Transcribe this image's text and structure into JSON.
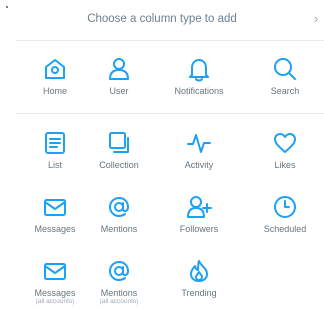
{
  "header": {
    "title": "Choose a column type to add",
    "close_glyph": "›"
  },
  "accent_color": "#1da1f2",
  "rows": [
    [
      {
        "name": "home",
        "label": "Home",
        "icon": "home-icon"
      },
      {
        "name": "user",
        "label": "User",
        "icon": "user-icon"
      },
      {
        "name": "notifications",
        "label": "Notifications",
        "icon": "bell-icon"
      },
      {
        "name": "search",
        "label": "Search",
        "icon": "search-icon"
      }
    ],
    [
      {
        "name": "list",
        "label": "List",
        "icon": "list-icon"
      },
      {
        "name": "collection",
        "label": "Collection",
        "icon": "collection-icon"
      },
      {
        "name": "activity",
        "label": "Activity",
        "icon": "activity-icon"
      },
      {
        "name": "likes",
        "label": "Likes",
        "icon": "heart-icon"
      }
    ],
    [
      {
        "name": "messages",
        "label": "Messages",
        "icon": "envelope-icon"
      },
      {
        "name": "mentions",
        "label": "Mentions",
        "icon": "at-icon"
      },
      {
        "name": "followers",
        "label": "Followers",
        "icon": "add-user-icon"
      },
      {
        "name": "scheduled",
        "label": "Scheduled",
        "icon": "clock-icon"
      }
    ],
    [
      {
        "name": "messages-all",
        "label": "Messages",
        "sub": "(all accounts)",
        "icon": "envelope-icon"
      },
      {
        "name": "mentions-all",
        "label": "Mentions",
        "sub": "(all accounts)",
        "icon": "at-icon"
      },
      {
        "name": "trending",
        "label": "Trending",
        "icon": "flame-icon"
      }
    ]
  ]
}
